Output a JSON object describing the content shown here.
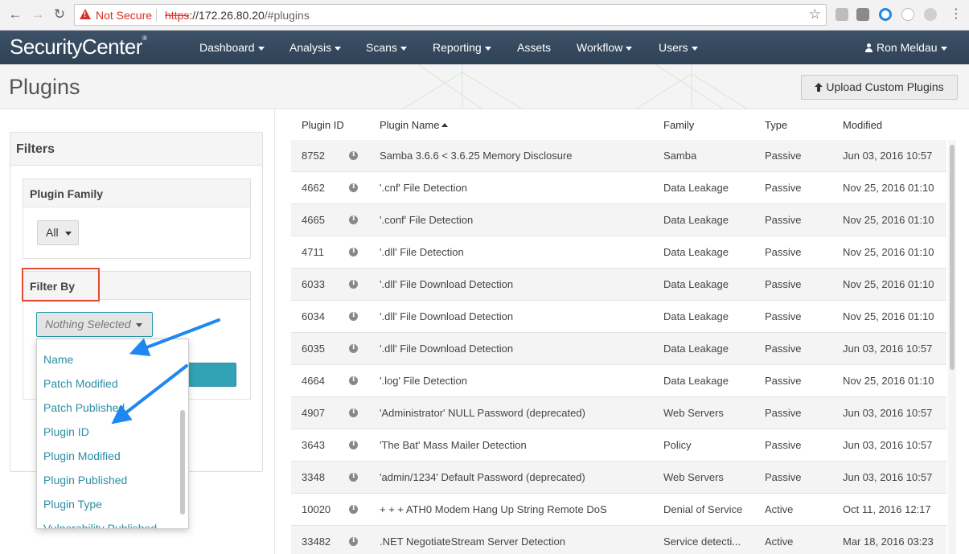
{
  "browser": {
    "security_label": "Not Secure",
    "url_scheme": "https",
    "url_host": "://172.26.80.20",
    "url_path": "/#plugins"
  },
  "app": {
    "logo": "SecurityCenter",
    "menu": [
      "Dashboard",
      "Analysis",
      "Scans",
      "Reporting",
      "Assets",
      "Workflow",
      "Users"
    ],
    "user": "Ron Meldau"
  },
  "page": {
    "title": "Plugins",
    "upload_button": "Upload Custom Plugins"
  },
  "filters": {
    "title": "Filters",
    "plugin_family_label": "Plugin Family",
    "plugin_family_value": "All",
    "filter_by_label": "Filter By",
    "filter_by_value": "Nothing Selected",
    "options": [
      "Name",
      "Patch Modified",
      "Patch Published",
      "Plugin ID",
      "Plugin Modified",
      "Plugin Published",
      "Plugin Type",
      "Vulnerability Published"
    ]
  },
  "table": {
    "columns": [
      "Plugin ID",
      "Plugin Name",
      "Family",
      "Type",
      "Modified"
    ],
    "rows": [
      {
        "id": "8752",
        "name": "Samba 3.6.6 < 3.6.25 Memory Disclosure",
        "family": "Samba",
        "type": "Passive",
        "modified": "Jun 03, 2016 10:57"
      },
      {
        "id": "4662",
        "name": "'.cnf' File Detection",
        "family": "Data Leakage",
        "type": "Passive",
        "modified": "Nov 25, 2016 01:10"
      },
      {
        "id": "4665",
        "name": "'.conf' File Detection",
        "family": "Data Leakage",
        "type": "Passive",
        "modified": "Nov 25, 2016 01:10"
      },
      {
        "id": "4711",
        "name": "'.dll' File Detection",
        "family": "Data Leakage",
        "type": "Passive",
        "modified": "Nov 25, 2016 01:10"
      },
      {
        "id": "6033",
        "name": "'.dll' File Download Detection",
        "family": "Data Leakage",
        "type": "Passive",
        "modified": "Nov 25, 2016 01:10"
      },
      {
        "id": "6034",
        "name": "'.dll' File Download Detection",
        "family": "Data Leakage",
        "type": "Passive",
        "modified": "Nov 25, 2016 01:10"
      },
      {
        "id": "6035",
        "name": "'.dll' File Download Detection",
        "family": "Data Leakage",
        "type": "Passive",
        "modified": "Jun 03, 2016 10:57"
      },
      {
        "id": "4664",
        "name": "'.log' File Detection",
        "family": "Data Leakage",
        "type": "Passive",
        "modified": "Nov 25, 2016 01:10"
      },
      {
        "id": "4907",
        "name": "'Administrator' NULL Password (deprecated)",
        "family": "Web Servers",
        "type": "Passive",
        "modified": "Jun 03, 2016 10:57"
      },
      {
        "id": "3643",
        "name": "'The Bat' Mass Mailer Detection",
        "family": "Policy",
        "type": "Passive",
        "modified": "Jun 03, 2016 10:57"
      },
      {
        "id": "3348",
        "name": "'admin/1234' Default Password (deprecated)",
        "family": "Web Servers",
        "type": "Passive",
        "modified": "Jun 03, 2016 10:57"
      },
      {
        "id": "10020",
        "name": "+ + + ATH0 Modem Hang Up String Remote DoS",
        "family": "Denial of Service",
        "type": "Active",
        "modified": "Oct 11, 2016 12:17"
      },
      {
        "id": "33482",
        "name": ".NET NegotiateStream Server Detection",
        "family": "Service detecti...",
        "type": "Active",
        "modified": "Mar 18, 2016 03:23"
      }
    ]
  },
  "colors": {
    "header_bg": "#35495e",
    "accent_teal": "#31a3b4",
    "link_teal": "#2a8fa3",
    "highlight_red": "#e34c32",
    "annotation_blue": "#1e88f0"
  }
}
